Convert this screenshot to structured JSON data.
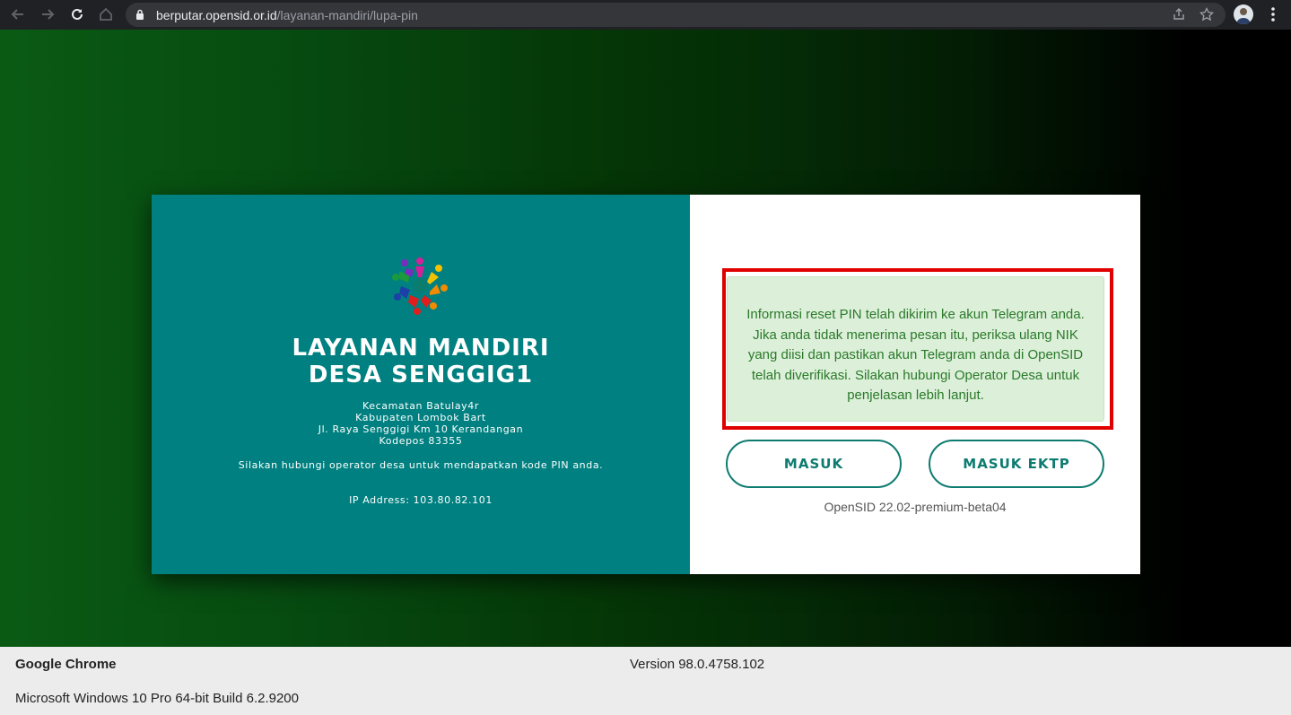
{
  "browser": {
    "url_domain": "berputar.opensid.or.id",
    "url_path": "/layanan-mandiri/lupa-pin"
  },
  "left_panel": {
    "title_line1": "LAYANAN MANDIRI",
    "title_line2": "DESA SENGGIG1",
    "address_lines": [
      "Kecamatan Batulay4r",
      "Kabupaten Lombok Bart",
      "Jl. Raya Senggigi Km 10 Kerandangan",
      "Kodepos 83355"
    ],
    "note": "Silakan hubungi operator desa untuk mendapatkan kode PIN anda.",
    "ip": "IP Address: 103.80.82.101"
  },
  "right_panel": {
    "alert_text": "Informasi reset PIN telah dikirim ke akun Telegram anda. Jika anda tidak menerima pesan itu, periksa ulang NIK yang diisi dan pastikan akun Telegram anda di OpenSID telah diverifikasi. Silakan hubungi Operator Desa untuk penjelasan lebih lanjut.",
    "masuk_label": "MASUK",
    "masuk_ektp_label": "MASUK EKTP",
    "version": "OpenSID 22.02-premium-beta04"
  },
  "footer": {
    "app_name": "Google Chrome",
    "version": "Version 98.0.4758.102",
    "os": "Microsoft Windows 10 Pro 64-bit Build 6.2.9200"
  },
  "colors": {
    "teal_panel": "#008080",
    "button_accent": "#0d7b70",
    "alert_bg": "#dcefd9",
    "alert_text": "#2a7a2a",
    "highlight_border": "#e00000"
  },
  "icons": [
    "back-icon",
    "forward-icon",
    "reload-icon",
    "home-icon",
    "lock-icon",
    "share-icon",
    "star-icon",
    "avatar",
    "kebab-menu-icon",
    "village-logo"
  ]
}
